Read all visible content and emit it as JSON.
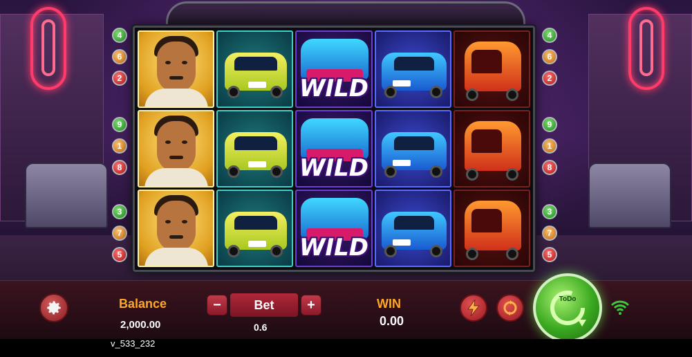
{
  "paylines": {
    "left": [
      {
        "num": "4",
        "color": "green"
      },
      {
        "num": "6",
        "color": "orange"
      },
      {
        "num": "2",
        "color": "red"
      },
      {
        "num": "9",
        "color": "green"
      },
      {
        "num": "1",
        "color": "orange"
      },
      {
        "num": "8",
        "color": "red"
      },
      {
        "num": "3",
        "color": "green"
      },
      {
        "num": "7",
        "color": "orange"
      },
      {
        "num": "5",
        "color": "red"
      }
    ],
    "right": [
      {
        "num": "4",
        "color": "green"
      },
      {
        "num": "6",
        "color": "orange"
      },
      {
        "num": "2",
        "color": "red"
      },
      {
        "num": "9",
        "color": "green"
      },
      {
        "num": "1",
        "color": "orange"
      },
      {
        "num": "8",
        "color": "red"
      },
      {
        "num": "3",
        "color": "green"
      },
      {
        "num": "7",
        "color": "orange"
      },
      {
        "num": "5",
        "color": "red"
      }
    ]
  },
  "reels": {
    "columns": [
      "man",
      "taxi",
      "wild",
      "cab",
      "tuk-tuk"
    ],
    "wild_label": "WILD"
  },
  "controls": {
    "balance_label": "Balance",
    "balance_value": "2,000.00",
    "bet_label": "Bet",
    "bet_value": "0.6",
    "minus_label": "−",
    "plus_label": "+",
    "win_label": "WIN",
    "win_value": "0.00",
    "spin_label": "ToDo"
  },
  "version": "v_533_232",
  "colors": {
    "gold": "#ffa726",
    "spin_green": "#3aa820",
    "button_red": "#9a1c24"
  }
}
